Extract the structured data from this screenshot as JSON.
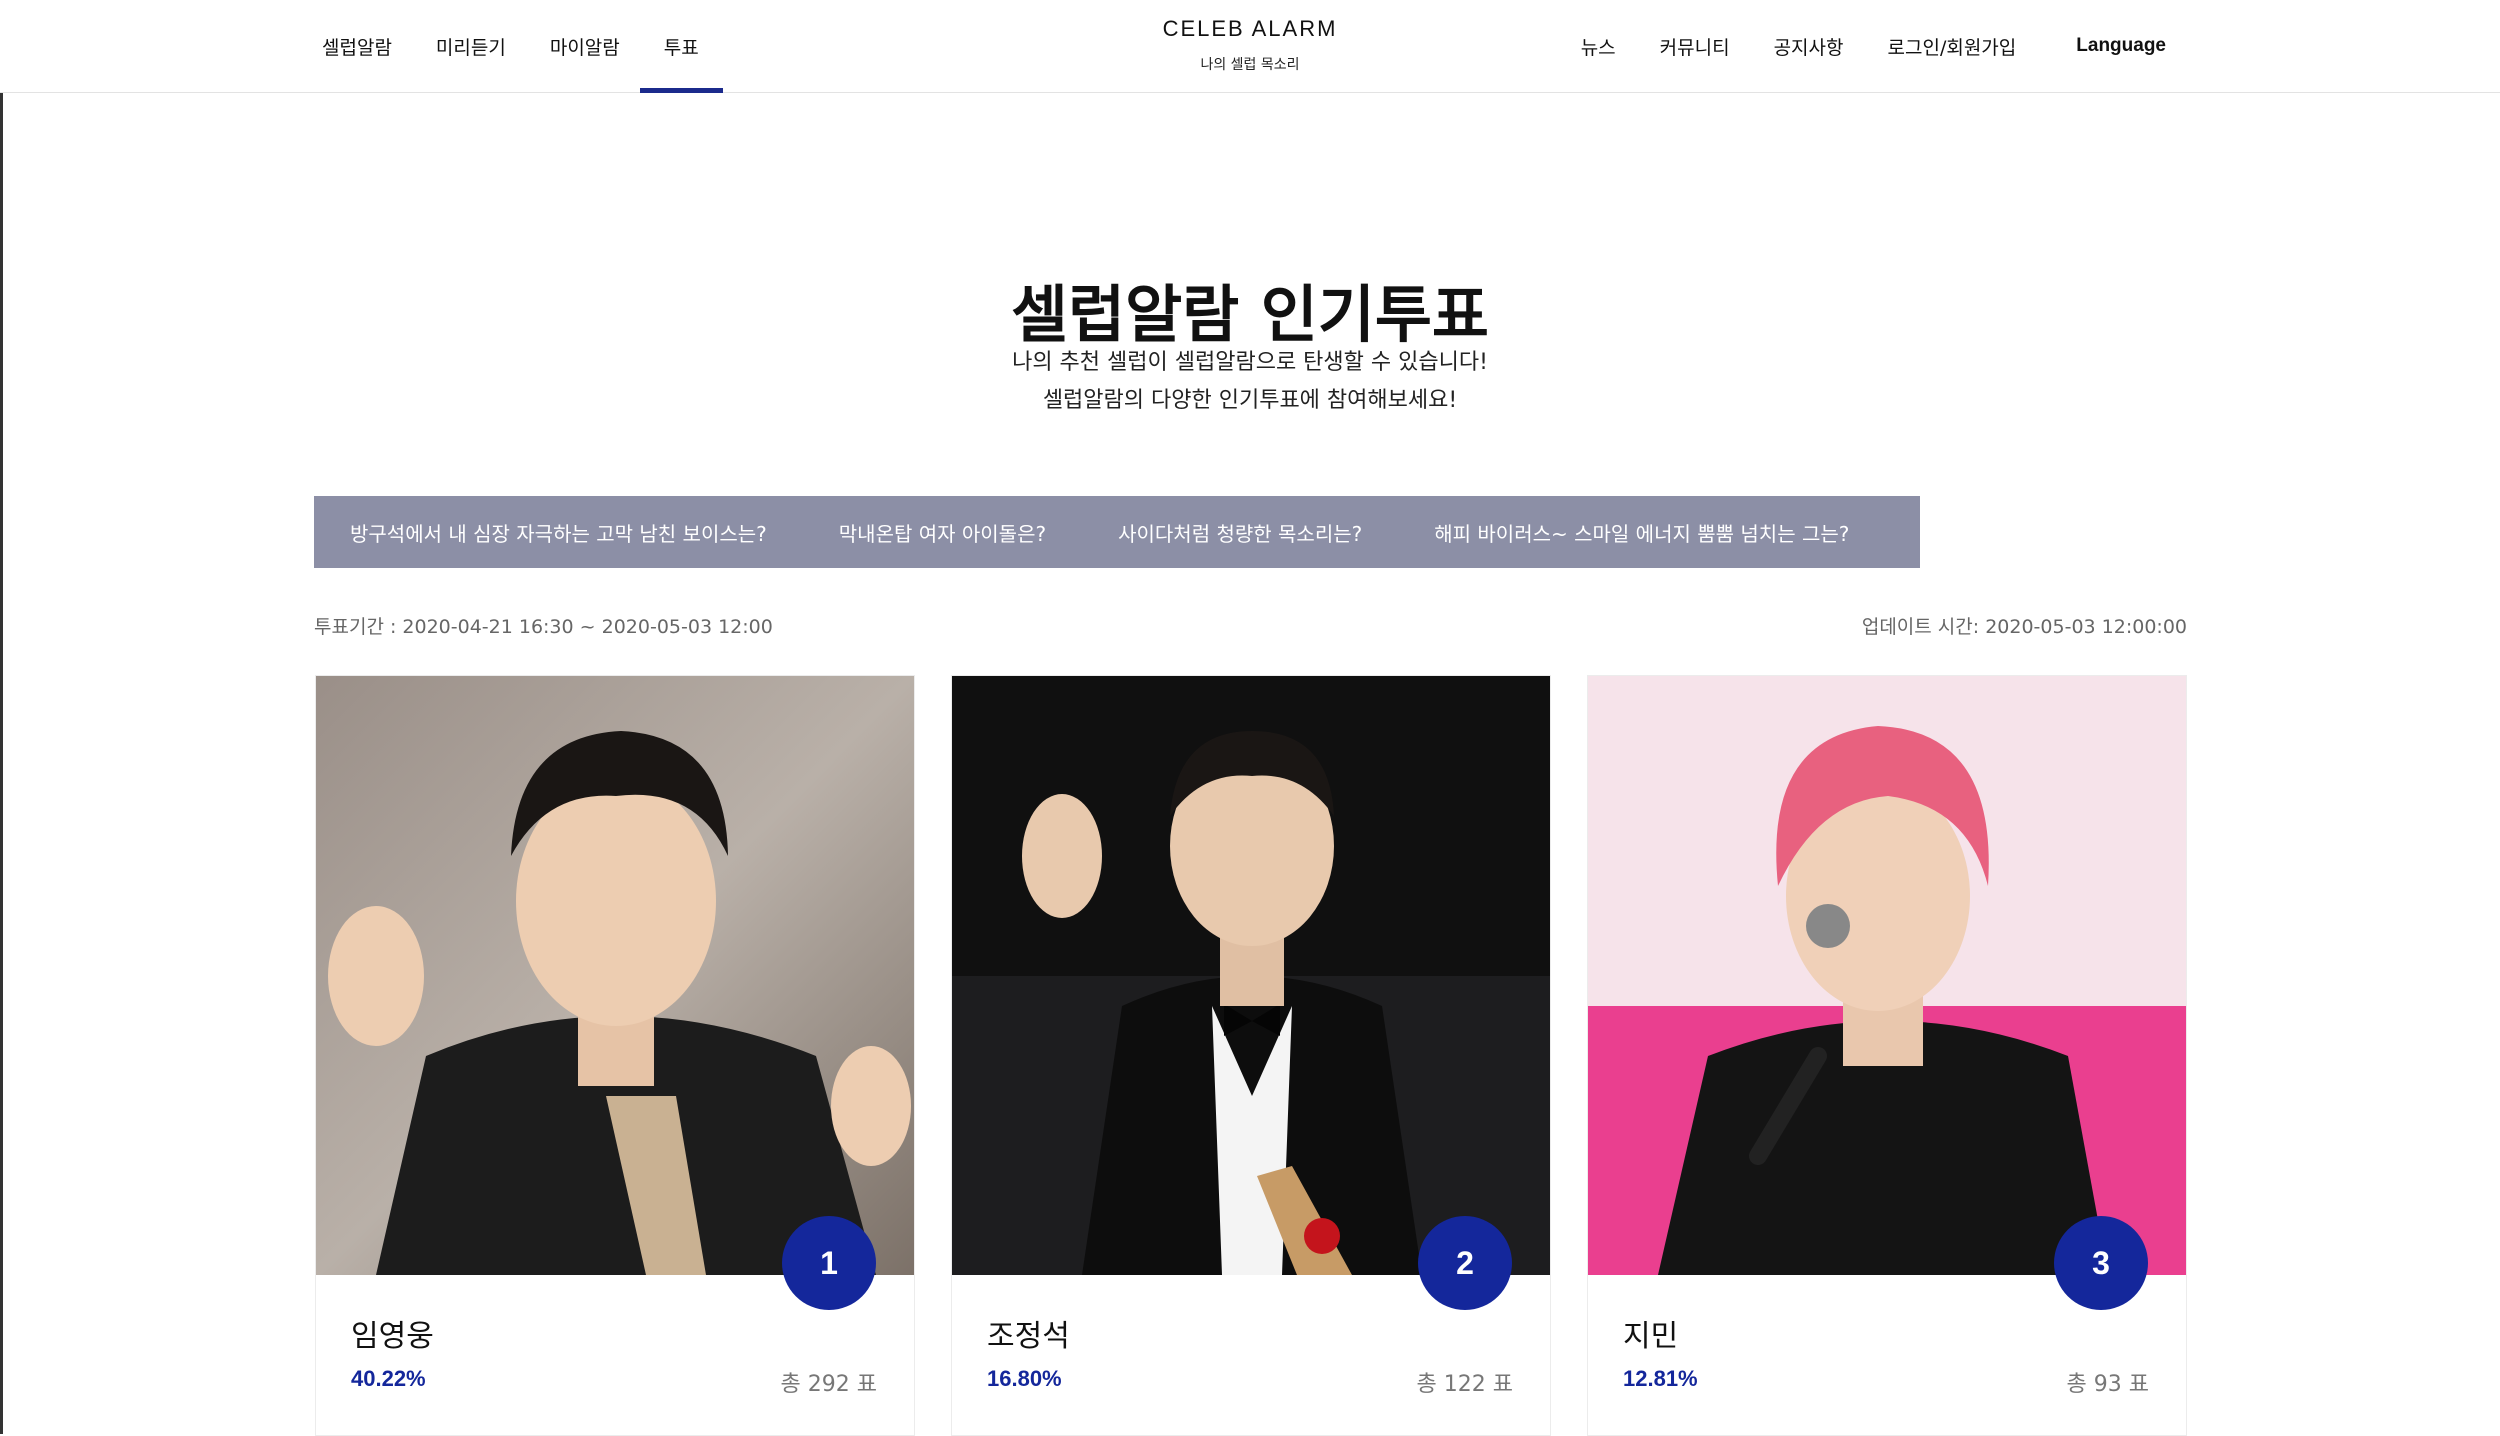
{
  "header": {
    "nav_left": [
      "셀럽알람",
      "미리듣기",
      "마이알람",
      "투표"
    ],
    "nav_right": [
      "뉴스",
      "커뮤니티",
      "공지사항",
      "로그인/회원가입"
    ],
    "language": "Language",
    "logo_title": "CELEB ALARM",
    "logo_sub": "나의 셀럽 목소리",
    "accent_color": "#1b2a8c"
  },
  "main": {
    "title": "셀럽알람 인기투표",
    "intro_line1": "나의 추천 셀럽이 셀럽알람으로 탄생할 수 있습니다!",
    "intro_line2": "셀럽알람의 다양한 인기투표에 참여해보세요!",
    "tabs": [
      "방구석에서 내 심장 자극하는 고막 남친 보이스는?",
      "막내온탑 여자 아이돌은?",
      "사이다처럼 청량한 목소리는?",
      "해피 바이러스~ 스마일 에너지 뿜뿜 넘치는 그는?"
    ],
    "period": "투표기간 : 2020-04-21 16:30 ~ 2020-05-03 12:00",
    "updated": "업데이트 시간: 2020-05-03 12:00:00",
    "candidates": [
      {
        "rank": "1",
        "name": "임영웅",
        "percent": "40.22%",
        "votes": "총 292 표"
      },
      {
        "rank": "2",
        "name": "조정석",
        "percent": "16.80%",
        "votes": "총 122 표"
      },
      {
        "rank": "3",
        "name": "지민",
        "percent": "12.81%",
        "votes": "총 93 표"
      }
    ]
  }
}
